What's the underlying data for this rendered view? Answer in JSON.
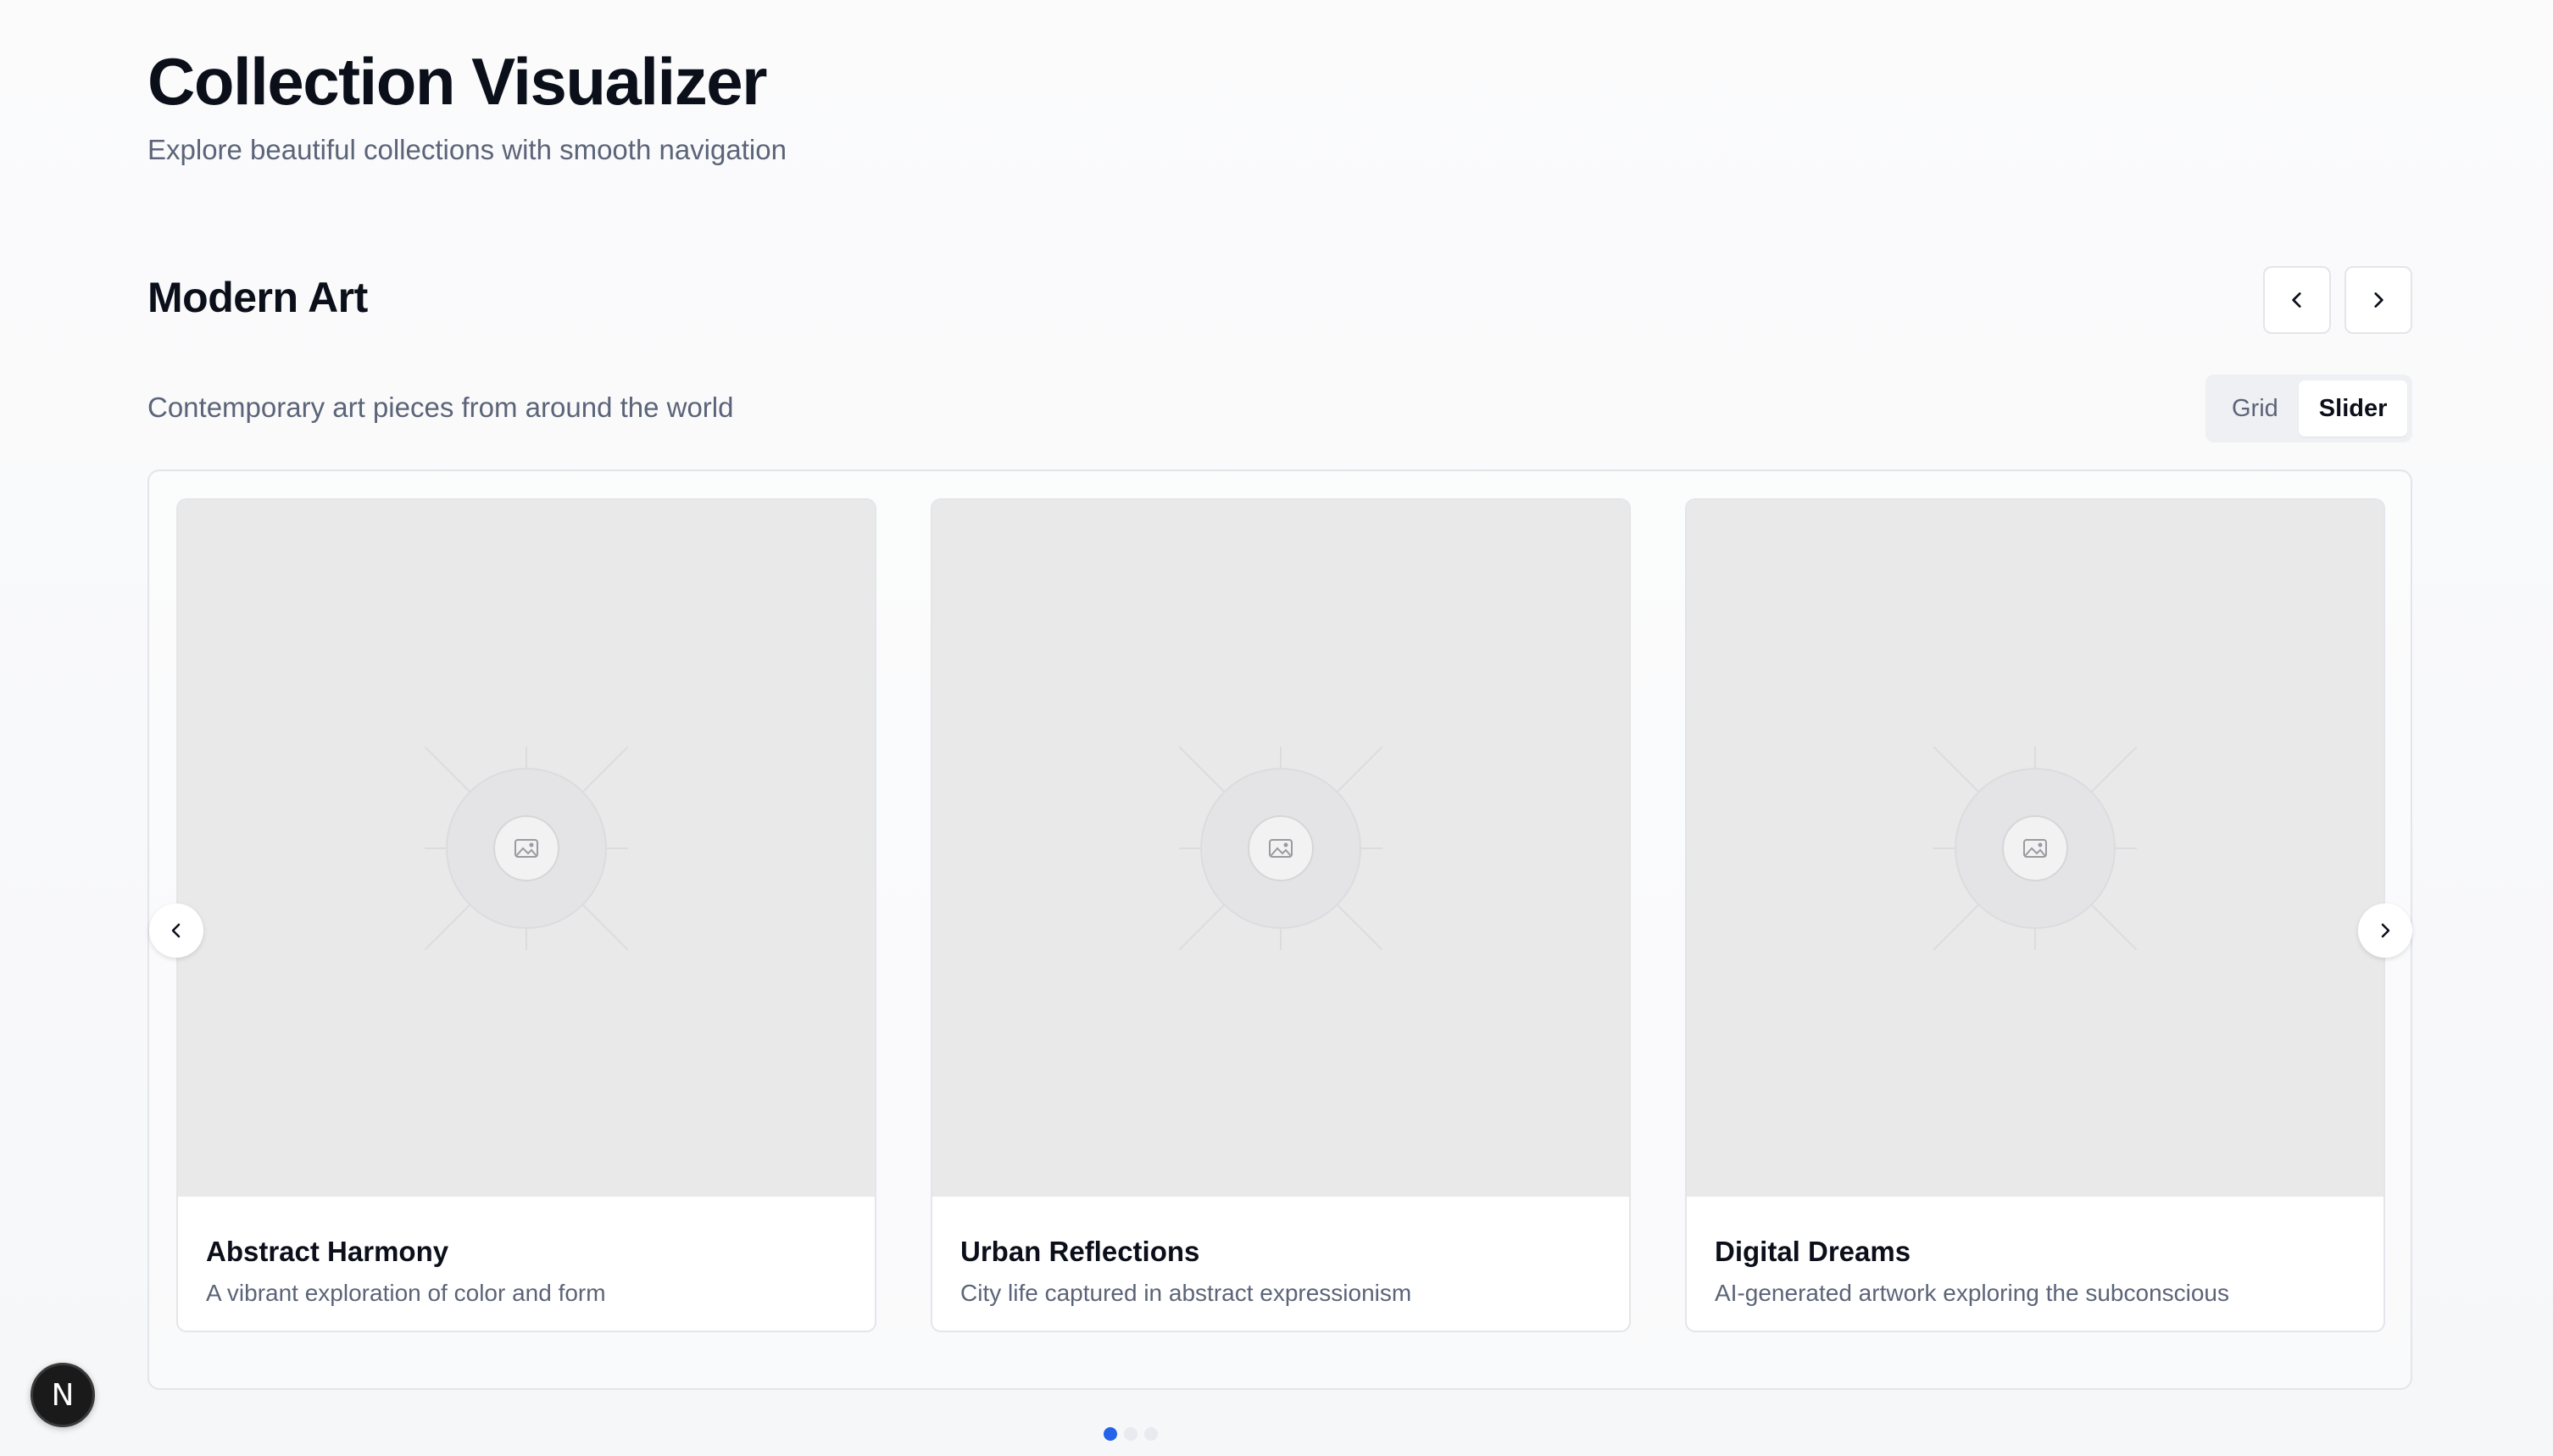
{
  "header": {
    "title": "Collection Visualizer",
    "subtitle": "Explore beautiful collections with smooth navigation"
  },
  "collection": {
    "title": "Modern Art",
    "description": "Contemporary art pieces from around the world",
    "view_toggle": {
      "options": [
        "Grid",
        "Slider"
      ],
      "selected": "Slider"
    },
    "items": [
      {
        "title": "Abstract Harmony",
        "description": "A vibrant exploration of color and form"
      },
      {
        "title": "Urban Reflections",
        "description": "City life captured in abstract expressionism"
      },
      {
        "title": "Digital Dreams",
        "description": "AI-generated artwork exploring the subconscious"
      }
    ],
    "pagination": {
      "pages": 3,
      "current": 1
    }
  },
  "icons": {
    "prev": "chevron-left-icon",
    "next": "chevron-right-icon",
    "placeholder": "image-icon",
    "dev_badge": "N"
  },
  "colors": {
    "accent": "#2563eb",
    "text": "#0b0f1a",
    "muted": "#5b6478"
  }
}
